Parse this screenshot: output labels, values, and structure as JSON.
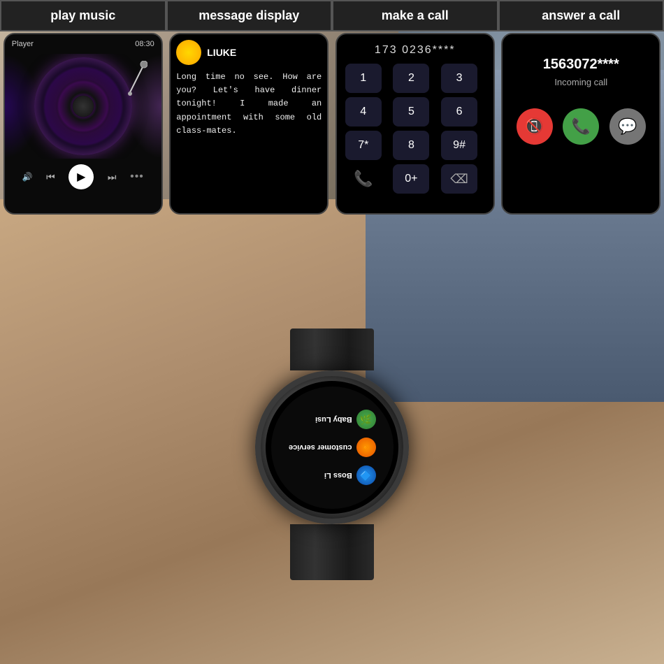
{
  "panels": {
    "music": {
      "label": "play music",
      "player_label": "Player",
      "time": "08:30",
      "controls": {
        "volume": "◀",
        "prev": "⏮",
        "play": "▶",
        "next": "⏭",
        "more": "..."
      }
    },
    "message": {
      "label": "message display",
      "sender": "LIUKE",
      "body": "Long time no see. How are you? Let's have dinner tonight! I made an appointment with some old class-mates."
    },
    "call": {
      "label": "make a call",
      "number": "173 0236****",
      "keys": [
        "1",
        "2",
        "3",
        "4",
        "5",
        "6",
        "7*",
        "8",
        "9#",
        "📞",
        "0+",
        "⌫"
      ]
    },
    "answer": {
      "label": "answer a call",
      "number": "1563072****",
      "status": "Incoming call",
      "decline_icon": "📵",
      "accept_icon": "📞",
      "message_icon": "💬"
    }
  },
  "watch": {
    "contacts": [
      {
        "name": "Baby Lusi",
        "avatar_color": "green",
        "symbol": "🌿"
      },
      {
        "name": "customer service",
        "avatar_color": "orange",
        "symbol": "🔸"
      },
      {
        "name": "Boss Li",
        "avatar_color": "blue",
        "symbol": "🔷"
      }
    ]
  }
}
